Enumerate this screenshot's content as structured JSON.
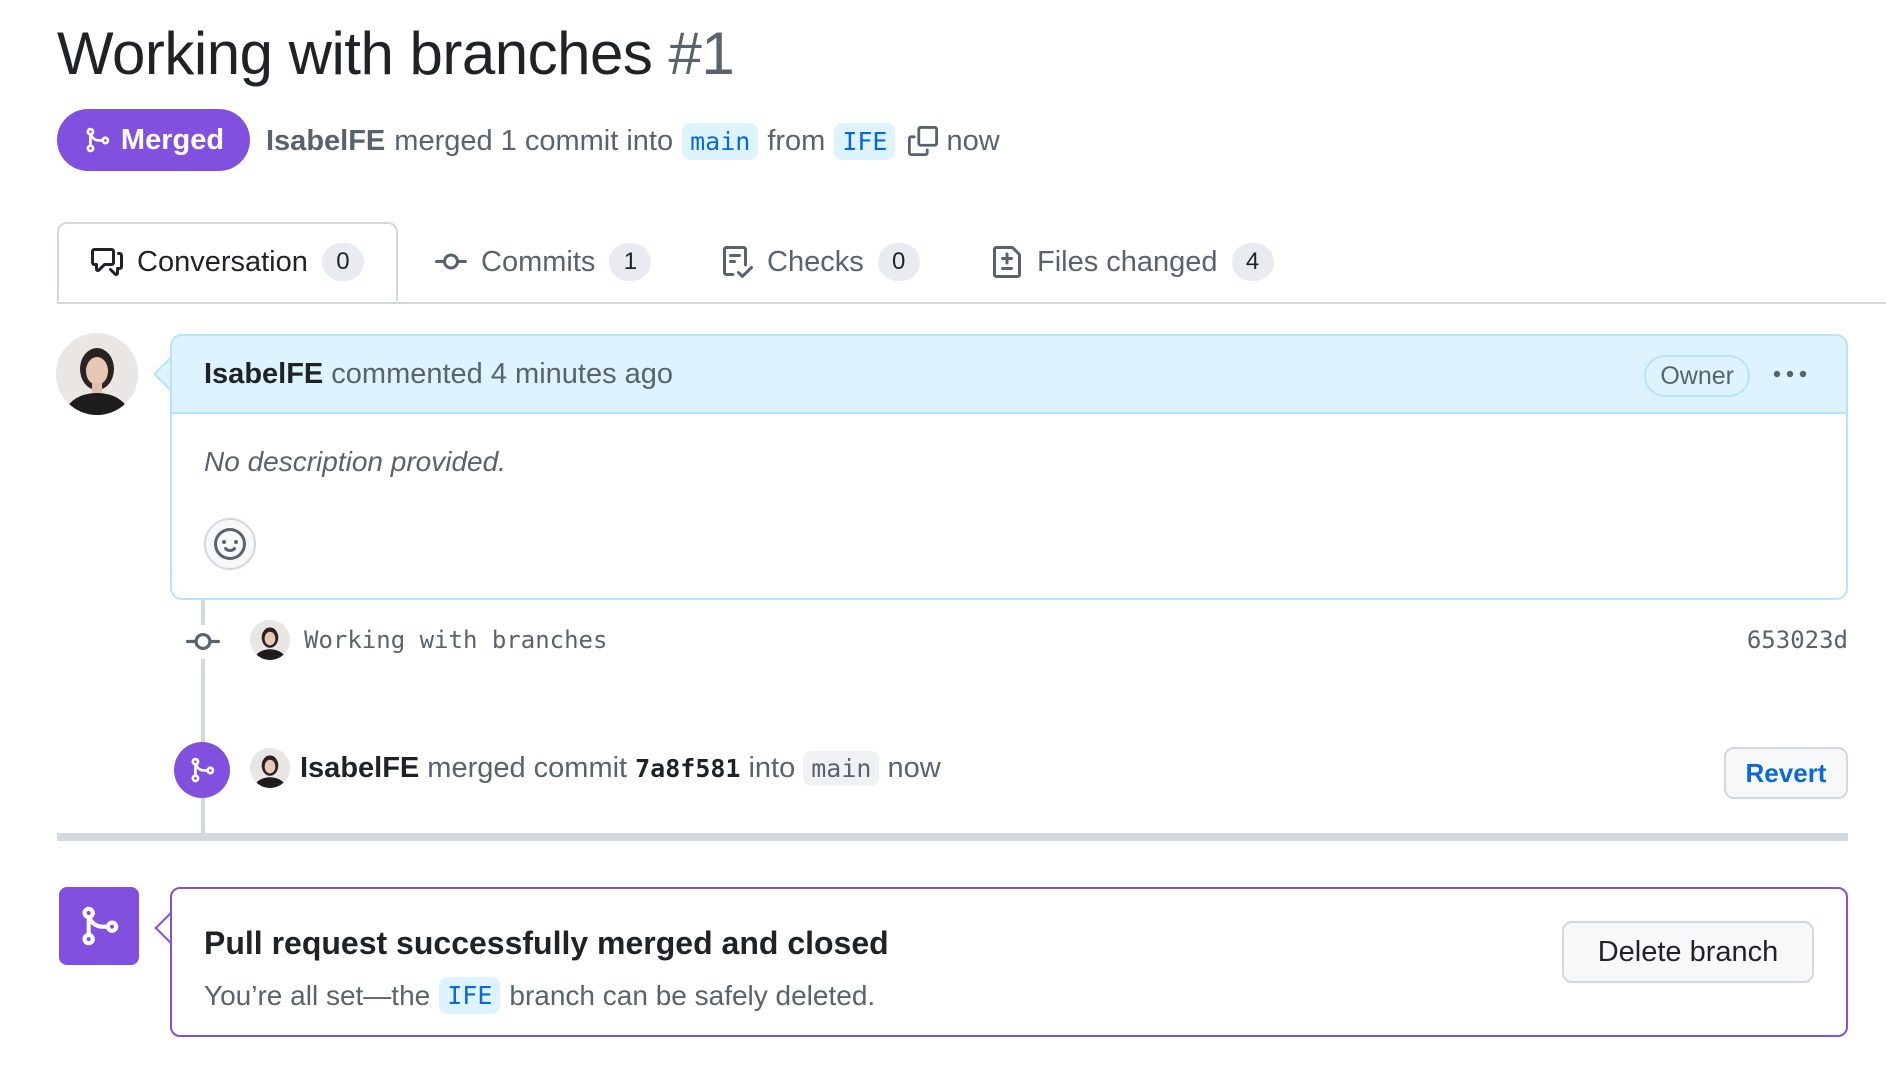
{
  "pr": {
    "title": "Working with branches",
    "number": "#1",
    "state": "Merged",
    "author": "IsabelFE",
    "summary_merged": "merged 1 commit into",
    "base_branch": "main",
    "from_word": "from",
    "head_branch": "IFE",
    "time": "now"
  },
  "tabs": [
    {
      "label": "Conversation",
      "count": "0",
      "icon": "comment-discussion-icon"
    },
    {
      "label": "Commits",
      "count": "1",
      "icon": "git-commit-icon"
    },
    {
      "label": "Checks",
      "count": "0",
      "icon": "checklist-icon"
    },
    {
      "label": "Files changed",
      "count": "4",
      "icon": "file-diff-icon"
    }
  ],
  "comment": {
    "author": "IsabelFE",
    "meta": "commented 4 minutes ago",
    "role_badge": "Owner",
    "body": "No description provided."
  },
  "commit": {
    "message": "Working with branches",
    "sha": "653023d"
  },
  "merge_event": {
    "author": "IsabelFE",
    "text_merged": "merged commit",
    "sha": "7a8f581",
    "text_into": "into",
    "branch": "main",
    "time": "now",
    "revert_label": "Revert"
  },
  "merged_box": {
    "heading": "Pull request successfully merged and closed",
    "sub_before": "You’re all set—the",
    "branch": "IFE",
    "sub_after": "branch can be safely deleted.",
    "delete_label": "Delete branch"
  },
  "colors": {
    "merged_purple": "#8250df",
    "link_blue": "#0969da",
    "comment_header_bg": "#ddf4ff"
  }
}
